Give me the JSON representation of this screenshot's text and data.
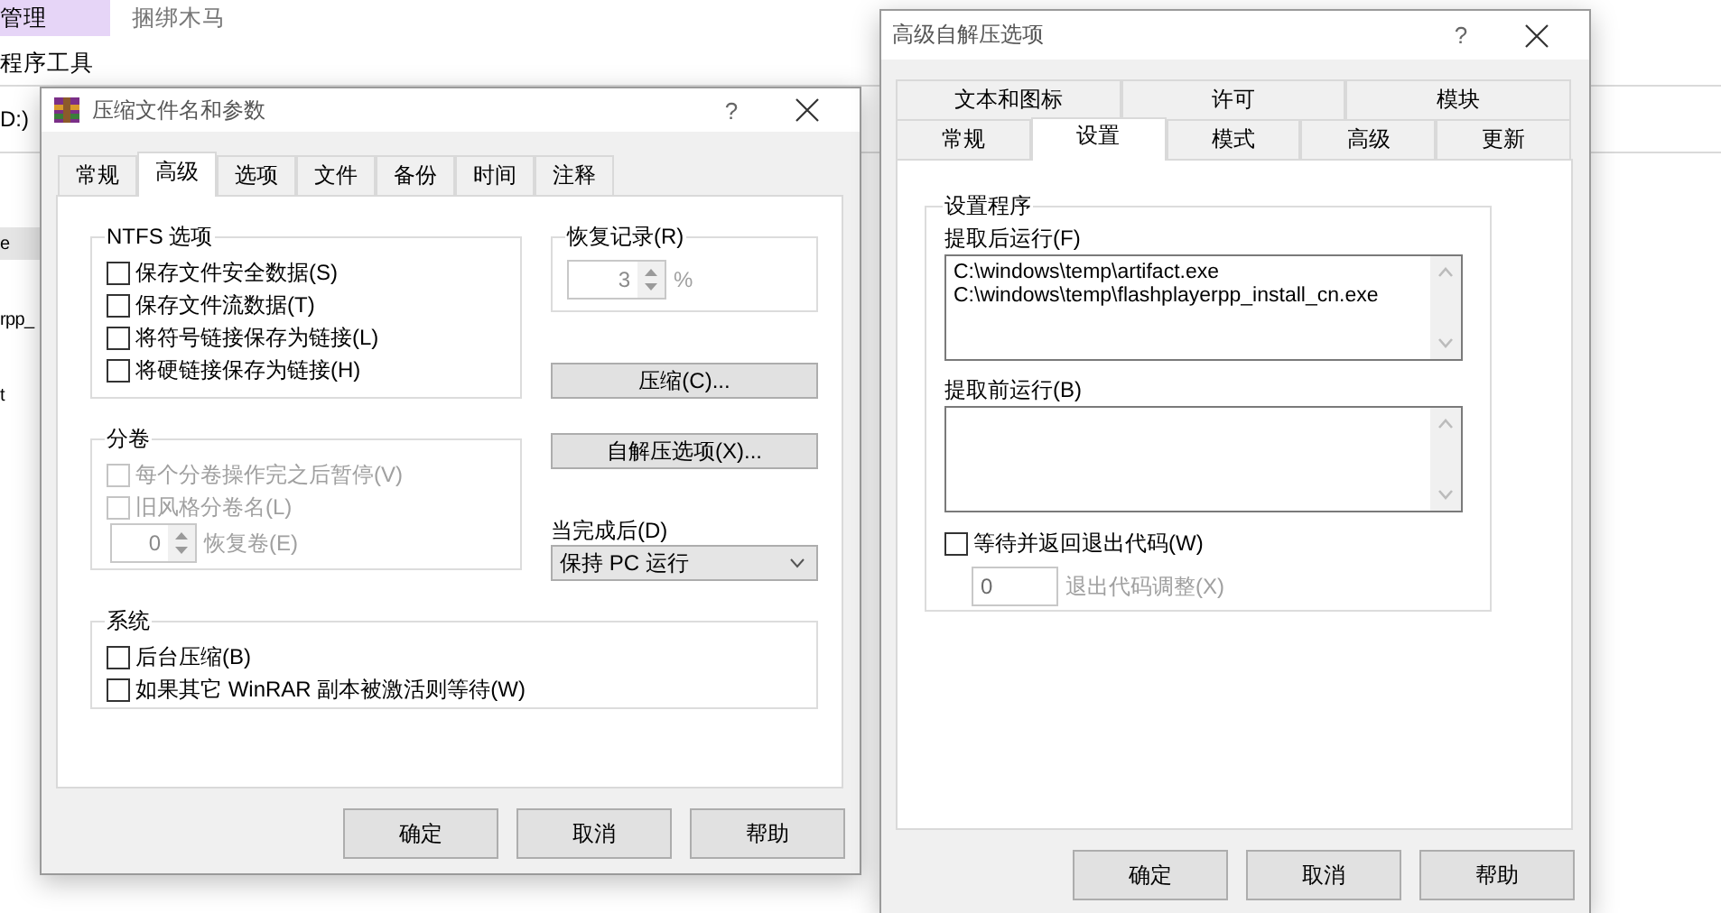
{
  "explorer": {
    "ribbon_items": [
      {
        "label": "管理",
        "selected": true
      },
      {
        "label": "程序工具",
        "selected": false
      }
    ],
    "title_hint": "捆绑木马",
    "address_fragment": "D:)",
    "file_fragments": [
      {
        "text": "e",
        "selected": true
      },
      {
        "text": "rpp_",
        "selected": false
      },
      {
        "text": "t",
        "selected": false
      }
    ]
  },
  "archive_dialog": {
    "title": "压缩文件名和参数",
    "help": "?",
    "tabs": [
      {
        "label": "常规",
        "selected": false
      },
      {
        "label": "高级",
        "selected": true
      },
      {
        "label": "选项",
        "selected": false
      },
      {
        "label": "文件",
        "selected": false
      },
      {
        "label": "备份",
        "selected": false
      },
      {
        "label": "时间",
        "selected": false
      },
      {
        "label": "注释",
        "selected": false
      }
    ],
    "ntfs": {
      "title": "NTFS 选项",
      "options": [
        {
          "label": "保存文件安全数据(S)",
          "checked": false,
          "disabled": false
        },
        {
          "label": "保存文件流数据(T)",
          "checked": false,
          "disabled": false
        },
        {
          "label": "将符号链接保存为链接(L)",
          "checked": false,
          "disabled": false
        },
        {
          "label": "将硬链接保存为链接(H)",
          "checked": false,
          "disabled": false
        }
      ]
    },
    "volumes": {
      "title": "分卷",
      "options": [
        {
          "label": "每个分卷操作完之后暂停(V)",
          "checked": false,
          "disabled": true
        },
        {
          "label": "旧风格分卷名(L)",
          "checked": false,
          "disabled": true
        }
      ],
      "spin": {
        "value": "0",
        "label": "恢复卷(E)",
        "disabled": true
      }
    },
    "recovery": {
      "title": "恢复记录(R)",
      "value": "3",
      "unit": "%",
      "disabled": true
    },
    "action_buttons": [
      "压缩(C)...",
      "自解压选项(X)..."
    ],
    "after_done": {
      "label": "当完成后(D)",
      "value": "保持 PC 运行"
    },
    "system": {
      "title": "系统",
      "options": [
        {
          "label": "后台压缩(B)",
          "checked": false,
          "disabled": false
        },
        {
          "label": "如果其它 WinRAR 副本被激活则等待(W)",
          "checked": false,
          "disabled": false
        }
      ]
    },
    "buttons": [
      "确定",
      "取消",
      "帮助"
    ]
  },
  "sfx_dialog": {
    "title": "高级自解压选项",
    "help": "?",
    "tab_rows": [
      [
        {
          "label": "文本和图标",
          "selected": false
        },
        {
          "label": "许可",
          "selected": false
        },
        {
          "label": "模块",
          "selected": false
        }
      ],
      [
        {
          "label": "常规",
          "selected": false
        },
        {
          "label": "设置",
          "selected": true
        },
        {
          "label": "模式",
          "selected": false
        },
        {
          "label": "高级",
          "selected": false
        },
        {
          "label": "更新",
          "selected": false
        }
      ]
    ],
    "group_title": "设置程序",
    "run_after": {
      "label": "提取后运行(F)",
      "lines": [
        "C:\\windows\\temp\\artifact.exe",
        "C:\\windows\\temp\\flashplayerpp_install_cn.exe"
      ]
    },
    "run_before": {
      "label": "提取前运行(B)"
    },
    "wait_option": {
      "label": "等待并返回退出代码(W)",
      "checked": false,
      "disabled": false
    },
    "exit_code": {
      "value": "0",
      "label": "退出代码调整(X)",
      "disabled": true
    },
    "buttons": [
      "确定",
      "取消",
      "帮助"
    ]
  }
}
